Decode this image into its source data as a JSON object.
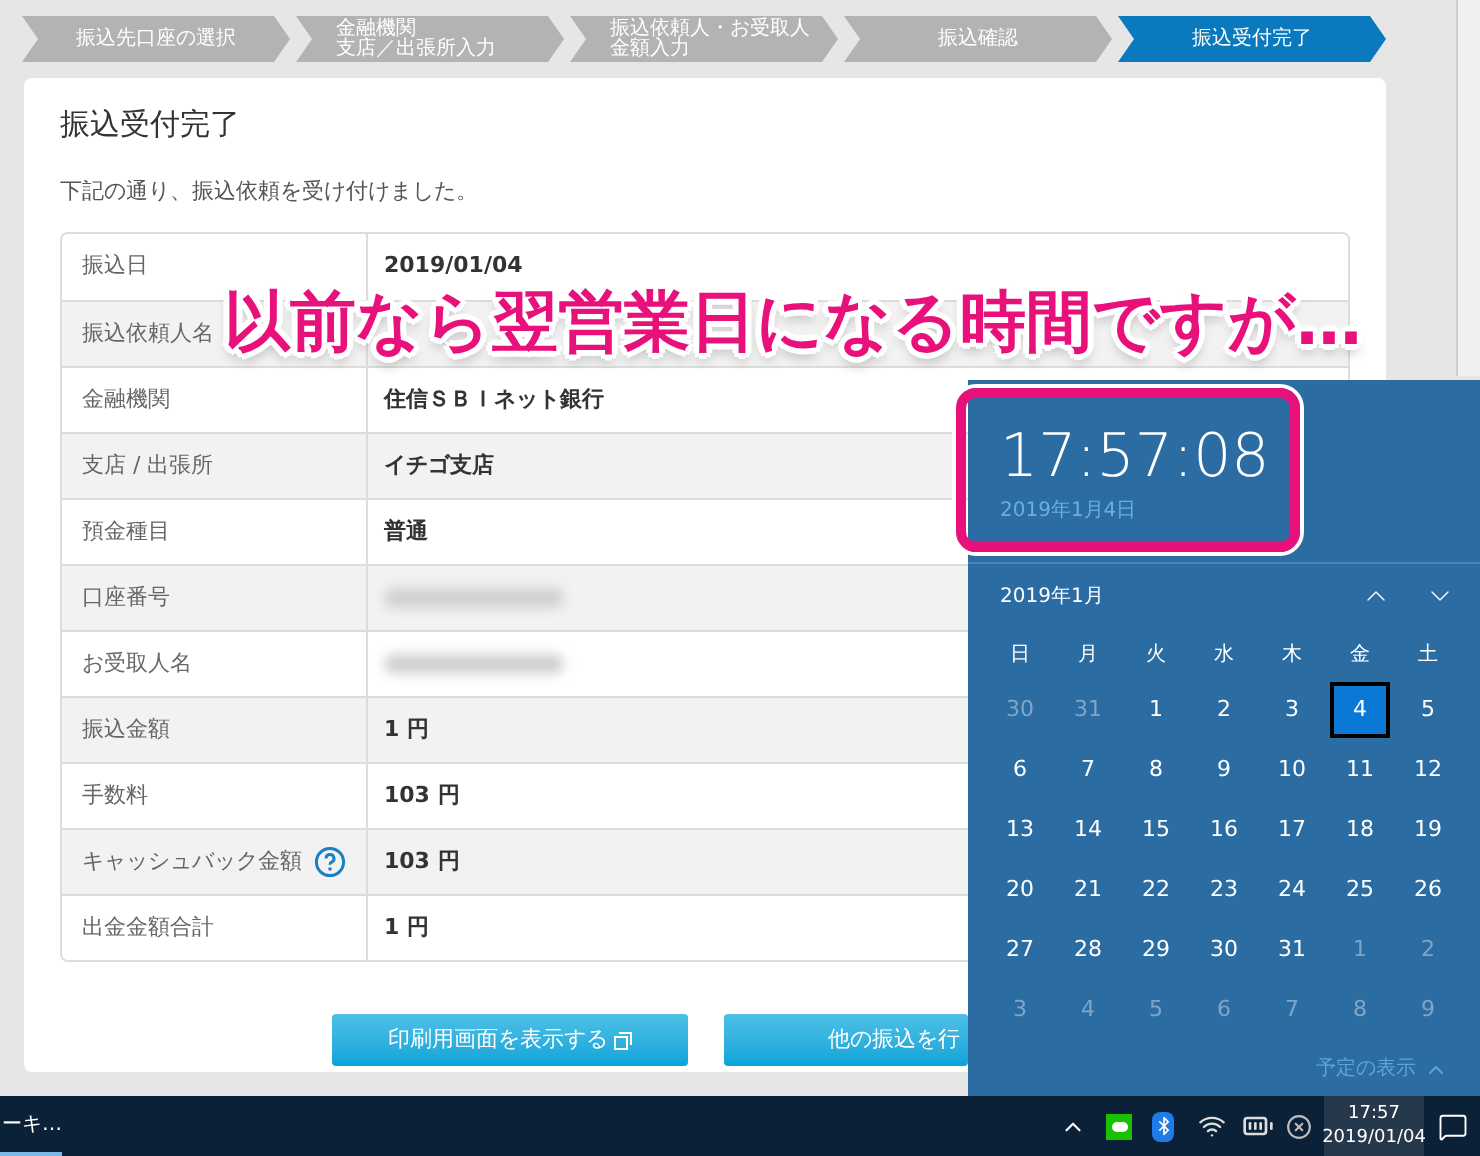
{
  "steps": [
    {
      "lines": [
        "振込先口座の選択"
      ],
      "selected": false
    },
    {
      "lines": [
        "金融機関",
        "支店／出張所入力"
      ],
      "selected": false
    },
    {
      "lines": [
        "振込依頼人・お受取人",
        "金額入力"
      ],
      "selected": false
    },
    {
      "lines": [
        "振込確認"
      ],
      "selected": false
    },
    {
      "lines": [
        "振込受付完了"
      ],
      "selected": true
    }
  ],
  "title": "振込受付完了",
  "message": "下記の通り、振込依頼を受け付けました。",
  "details": [
    {
      "label": "振込日",
      "kind": "text",
      "value": "2019/01/04"
    },
    {
      "label": "振込依頼人名",
      "kind": "covered"
    },
    {
      "label": "金融機関",
      "kind": "text",
      "value": "住信ＳＢＩネット銀行"
    },
    {
      "label": "支店 / 出張所",
      "kind": "text",
      "value": "イチゴ支店"
    },
    {
      "label": "預金種目",
      "kind": "text",
      "value": "普通"
    },
    {
      "label": "口座番号",
      "kind": "blurred"
    },
    {
      "label": "お受取人名",
      "kind": "blurred"
    },
    {
      "label": "振込金額",
      "kind": "text",
      "value": "1 円"
    },
    {
      "label": "手数料",
      "kind": "text",
      "value": "103 円"
    },
    {
      "label": "キャッシュバック金額",
      "kind": "text",
      "value": "103 円",
      "help": true
    },
    {
      "label": "出金金額合計",
      "kind": "text",
      "value": "1 円"
    }
  ],
  "buttons": [
    {
      "label": "印刷用画面を表示する",
      "external": true
    },
    {
      "label": "他の振込を行",
      "external": false
    }
  ],
  "annotation": "以前なら翌営業日になる時間ですが…",
  "clock": {
    "time": "17:57:08",
    "date": "2019年1月4日"
  },
  "calendar": {
    "month": "2019年1月",
    "weekdays": [
      "日",
      "月",
      "火",
      "水",
      "木",
      "金",
      "土"
    ],
    "weeks": [
      [
        {
          "day": "30",
          "muted": true,
          "selected": false
        },
        {
          "day": "31",
          "muted": true,
          "selected": false
        },
        {
          "day": "1",
          "muted": false,
          "selected": false
        },
        {
          "day": "2",
          "muted": false,
          "selected": false
        },
        {
          "day": "3",
          "muted": false,
          "selected": false
        },
        {
          "day": "4",
          "muted": false,
          "selected": true
        },
        {
          "day": "5",
          "muted": false,
          "selected": false
        }
      ],
      [
        {
          "day": "6",
          "muted": false,
          "selected": false
        },
        {
          "day": "7",
          "muted": false,
          "selected": false
        },
        {
          "day": "8",
          "muted": false,
          "selected": false
        },
        {
          "day": "9",
          "muted": false,
          "selected": false
        },
        {
          "day": "10",
          "muted": false,
          "selected": false
        },
        {
          "day": "11",
          "muted": false,
          "selected": false
        },
        {
          "day": "12",
          "muted": false,
          "selected": false
        }
      ],
      [
        {
          "day": "13",
          "muted": false,
          "selected": false
        },
        {
          "day": "14",
          "muted": false,
          "selected": false
        },
        {
          "day": "15",
          "muted": false,
          "selected": false
        },
        {
          "day": "16",
          "muted": false,
          "selected": false
        },
        {
          "day": "17",
          "muted": false,
          "selected": false
        },
        {
          "day": "18",
          "muted": false,
          "selected": false
        },
        {
          "day": "19",
          "muted": false,
          "selected": false
        }
      ],
      [
        {
          "day": "20",
          "muted": false,
          "selected": false
        },
        {
          "day": "21",
          "muted": false,
          "selected": false
        },
        {
          "day": "22",
          "muted": false,
          "selected": false
        },
        {
          "day": "23",
          "muted": false,
          "selected": false
        },
        {
          "day": "24",
          "muted": false,
          "selected": false
        },
        {
          "day": "25",
          "muted": false,
          "selected": false
        },
        {
          "day": "26",
          "muted": false,
          "selected": false
        }
      ],
      [
        {
          "day": "27",
          "muted": false,
          "selected": false
        },
        {
          "day": "28",
          "muted": false,
          "selected": false
        },
        {
          "day": "29",
          "muted": false,
          "selected": false
        },
        {
          "day": "30",
          "muted": false,
          "selected": false
        },
        {
          "day": "31",
          "muted": false,
          "selected": false
        },
        {
          "day": "1",
          "muted": true,
          "selected": false
        },
        {
          "day": "2",
          "muted": true,
          "selected": false
        }
      ],
      [
        {
          "day": "3",
          "muted": true,
          "selected": false
        },
        {
          "day": "4",
          "muted": true,
          "selected": false
        },
        {
          "day": "5",
          "muted": true,
          "selected": false
        },
        {
          "day": "6",
          "muted": true,
          "selected": false
        },
        {
          "day": "7",
          "muted": true,
          "selected": false
        },
        {
          "day": "8",
          "muted": true,
          "selected": false
        },
        {
          "day": "9",
          "muted": true,
          "selected": false
        }
      ]
    ],
    "agenda_link": "予定の表示"
  },
  "taskbar": {
    "app_label": "ーキ…",
    "time": "17:57",
    "date": "2019/01/04"
  }
}
